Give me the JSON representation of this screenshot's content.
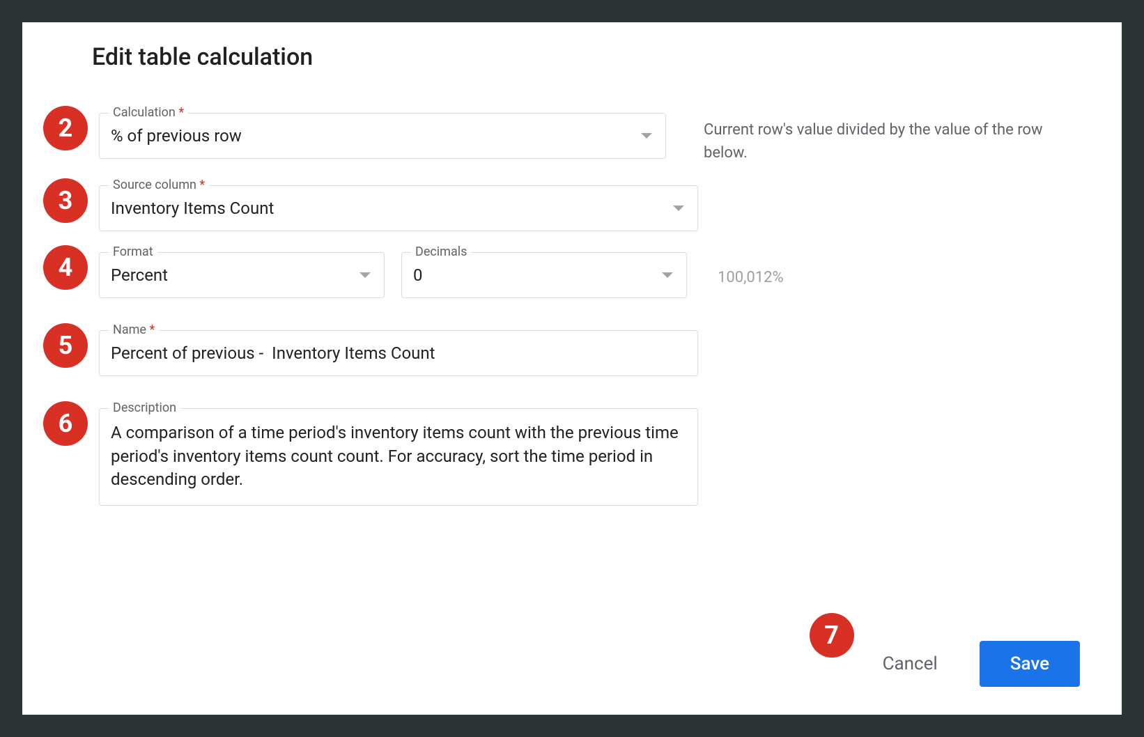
{
  "dialog": {
    "title": "Edit table calculation"
  },
  "annotations": {
    "calculation": "2",
    "source_column": "3",
    "format": "4",
    "name": "5",
    "description": "6",
    "save": "7"
  },
  "fields": {
    "calculation": {
      "label": "Calculation",
      "required_marker": "*",
      "value": "% of previous row",
      "helper": "Current row's value divided by the value of the row below."
    },
    "source_column": {
      "label": "Source column",
      "required_marker": "*",
      "value": "Inventory Items Count"
    },
    "format": {
      "label": "Format",
      "value": "Percent"
    },
    "decimals": {
      "label": "Decimals",
      "value": "0"
    },
    "format_example": "100,012%",
    "name": {
      "label": "Name",
      "required_marker": "*",
      "value": "Percent of previous -  Inventory Items Count"
    },
    "description": {
      "label": "Description",
      "value": "A comparison of a time period's inventory items count with the previous time period's inventory items count count. For accuracy, sort the time period in descending order."
    }
  },
  "actions": {
    "cancel": "Cancel",
    "save": "Save"
  }
}
